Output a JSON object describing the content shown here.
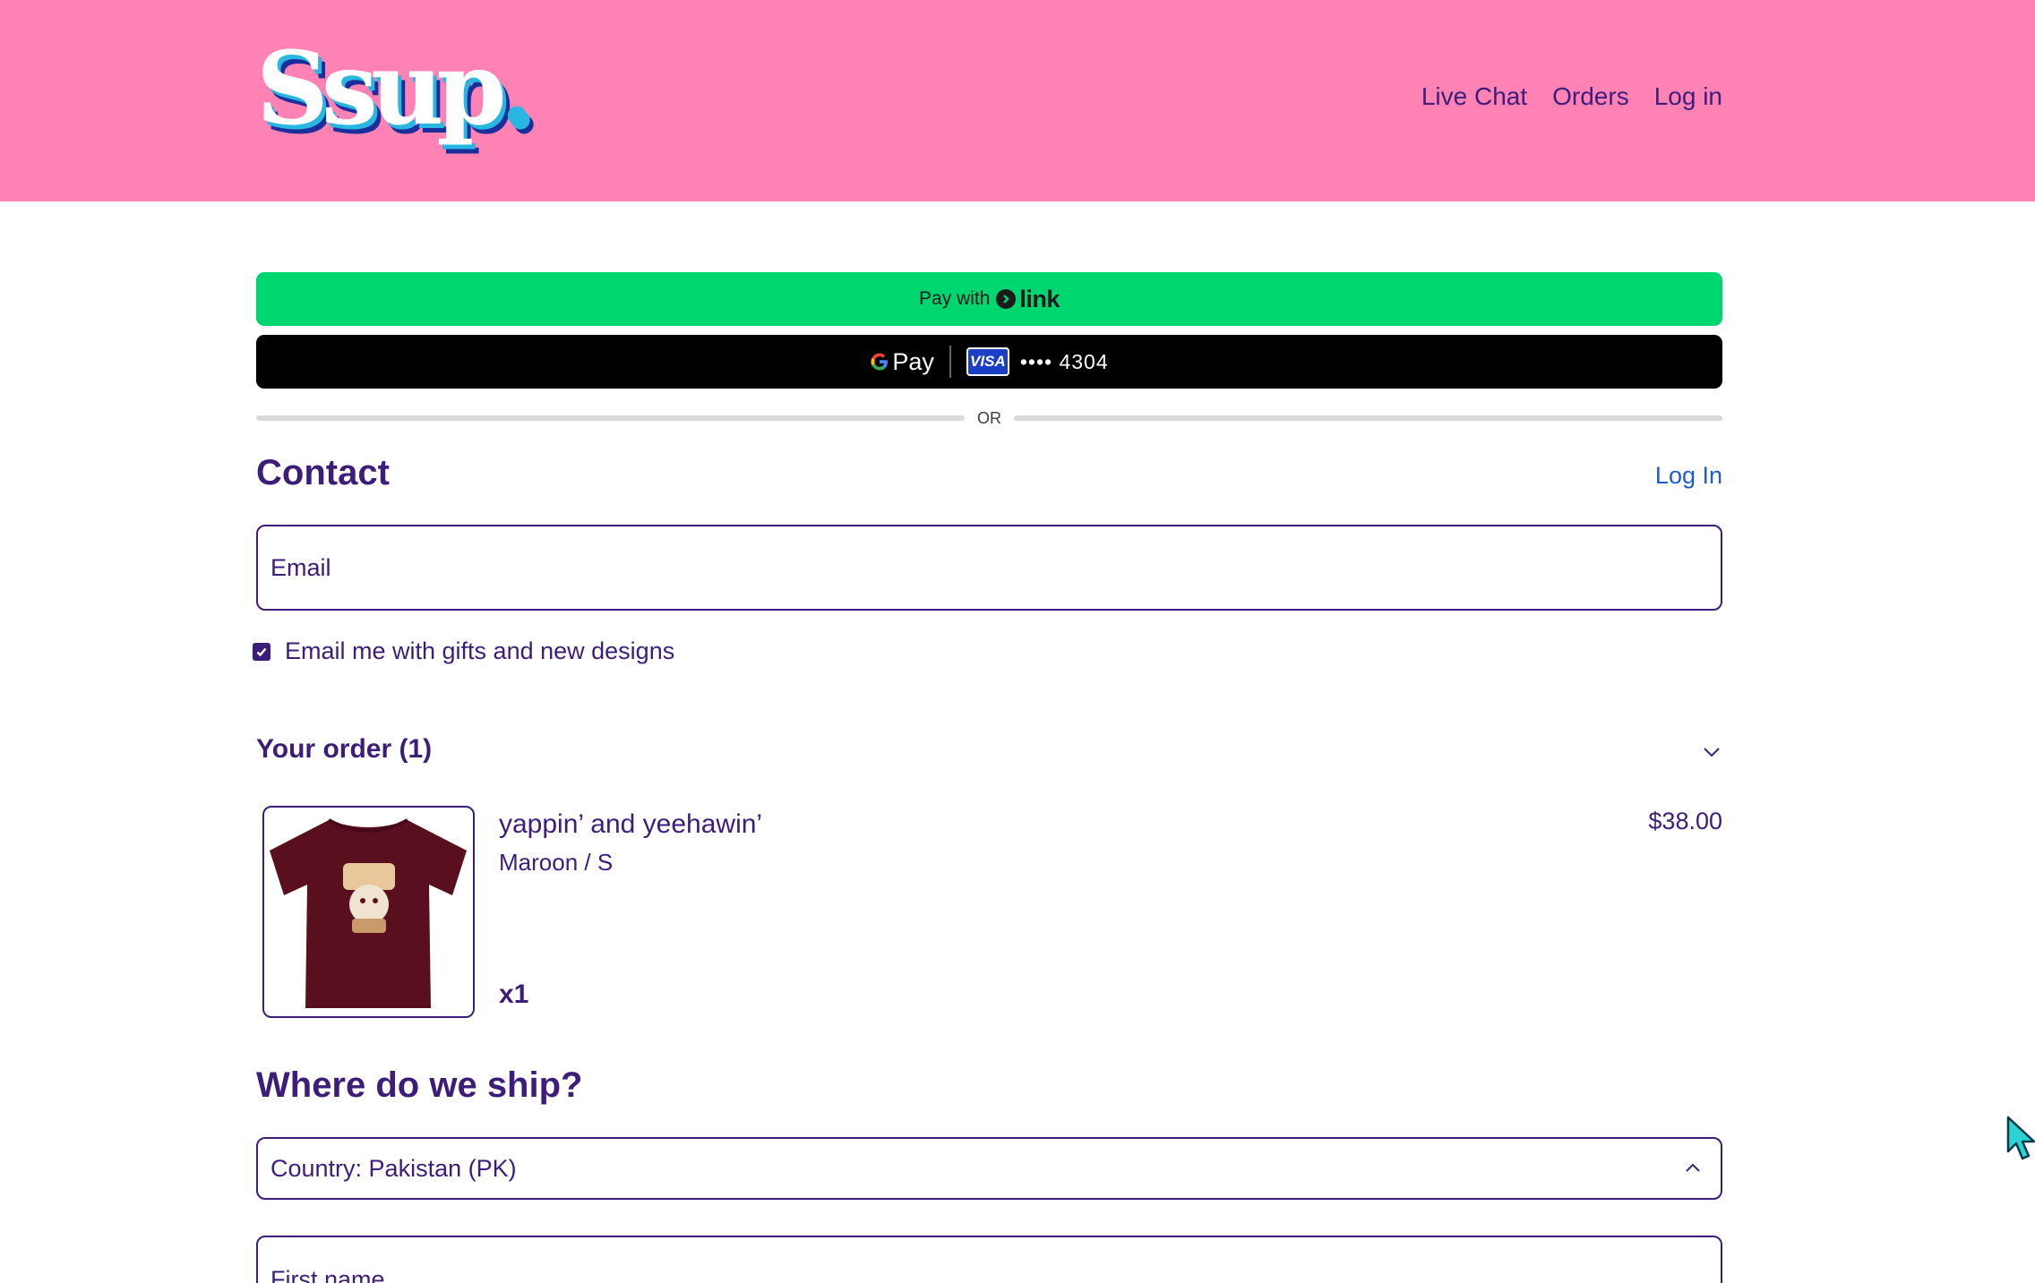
{
  "header": {
    "logo_text": "Ssup.",
    "nav": [
      "Live Chat",
      "Orders",
      "Log in"
    ]
  },
  "payment": {
    "link_prefix": "Pay with",
    "link_brand": "link",
    "gpay_brand": "Pay",
    "card_brand": "VISA",
    "card_last": "•••• 4304",
    "separator": "OR"
  },
  "contact": {
    "title": "Contact",
    "login": "Log In",
    "email_placeholder": "Email",
    "marketing_label": "Email me with gifts and new designs",
    "marketing_checked": true
  },
  "order": {
    "title": "Your order (1)",
    "items": [
      {
        "name": "yappin’ and yeehawin’",
        "variant": "Maroon / S",
        "quantity": "x1",
        "price": "$38.00",
        "color": "#5a0f1f"
      }
    ]
  },
  "shipping": {
    "title": "Where do we ship?",
    "country": "Country: Pakistan (PK)",
    "first_name_label": "First name"
  },
  "colors": {
    "header_bg": "#ff82b4",
    "text": "#3d1d7a",
    "link_green": "#00d66f",
    "link_blue": "#1e5bd6"
  },
  "icons": {
    "order_toggle": "chevron-down-icon",
    "country_toggle": "chevron-up-icon",
    "pointer": "cursor-icon"
  }
}
